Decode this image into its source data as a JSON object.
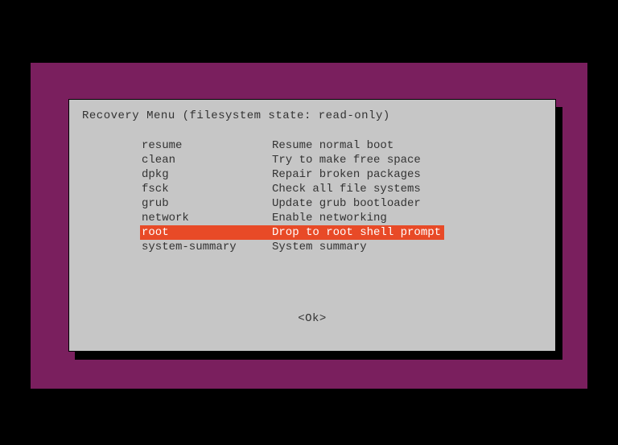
{
  "dialog": {
    "title": "Recovery Menu (filesystem state: read-only)",
    "items": [
      {
        "key": "resume",
        "desc": "Resume normal boot",
        "selected": false
      },
      {
        "key": "clean",
        "desc": "Try to make free space",
        "selected": false
      },
      {
        "key": "dpkg",
        "desc": "Repair broken packages",
        "selected": false
      },
      {
        "key": "fsck",
        "desc": "Check all file systems",
        "selected": false
      },
      {
        "key": "grub",
        "desc": "Update grub bootloader",
        "selected": false
      },
      {
        "key": "network",
        "desc": "Enable networking",
        "selected": false
      },
      {
        "key": "root",
        "desc": "Drop to root shell prompt",
        "selected": true
      },
      {
        "key": "system-summary",
        "desc": "System summary",
        "selected": false
      }
    ],
    "ok_label": "<Ok>"
  }
}
